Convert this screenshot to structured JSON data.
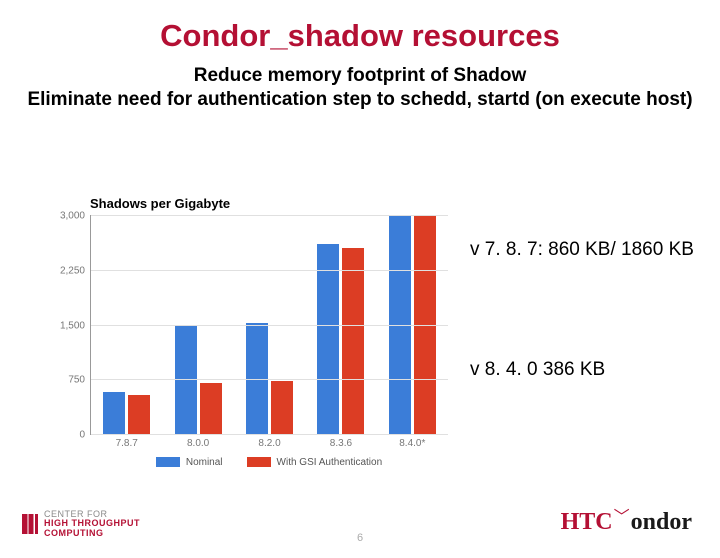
{
  "title": "Condor_shadow resources",
  "subtitle": "Reduce memory footprint of Shadow\nEliminate need for authentication step to schedd, startd (on execute host)",
  "chart_data": {
    "type": "bar",
    "title": "Shadows per Gigabyte",
    "categories": [
      "7.8.7",
      "8.0.0",
      "8.2.0",
      "8.3.6",
      "8.4.0*"
    ],
    "series": [
      {
        "name": "Nominal",
        "values": [
          580,
          1500,
          1520,
          2600,
          3000
        ]
      },
      {
        "name": "With GSI Authentication",
        "values": [
          540,
          700,
          720,
          2550,
          2990
        ]
      }
    ],
    "yticks": [
      0,
      750,
      1500,
      2250,
      3000
    ],
    "ylim": [
      0,
      3000
    ],
    "xlabel": "",
    "ylabel": "",
    "colors": [
      "#3b7dd8",
      "#dc3d24"
    ]
  },
  "annotations": {
    "a1": "v 7. 8. 7: 860 KB/ 1860 KB",
    "a2": "v 8. 4. 0 386 KB"
  },
  "page_number": "6",
  "logos": {
    "left_line1": "CENTER FOR",
    "left_line2": "HIGH THROUGHPUT",
    "left_line3": "COMPUTING",
    "right_ht": "HTC",
    "right_rest": "ondor"
  }
}
